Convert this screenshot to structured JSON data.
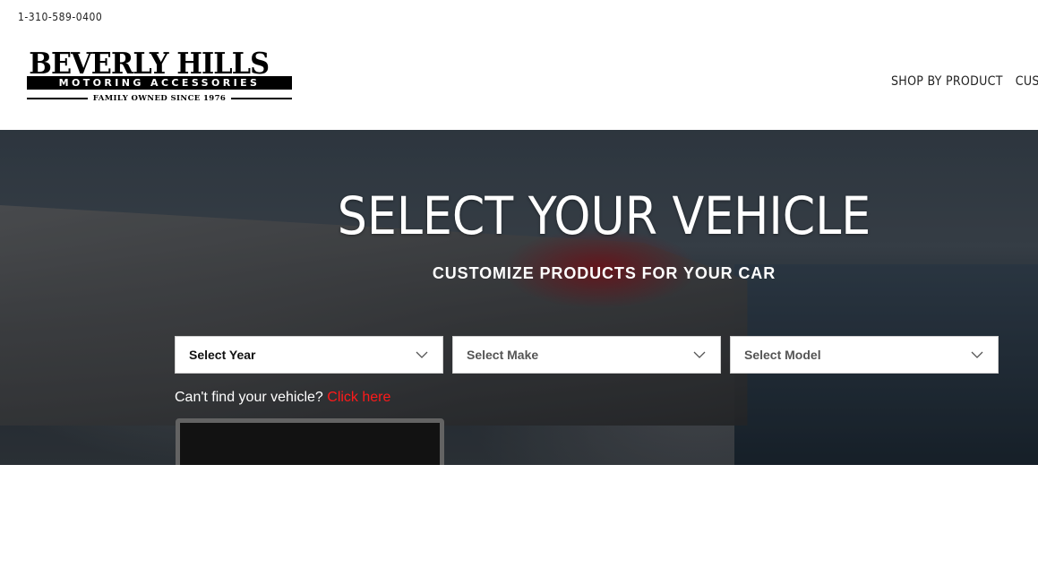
{
  "topbar": {
    "phone": "1-310-589-0400"
  },
  "logo": {
    "line1": "BEVERLY HILLS",
    "line2": "MOTORING ACCESSORIES",
    "tagline": "FAMILY OWNED SINCE 1976"
  },
  "nav": {
    "items": [
      {
        "label": "SHOP BY PRODUCT"
      },
      {
        "label": "CUSTO"
      }
    ]
  },
  "hero": {
    "title": "SELECT YOUR VEHICLE",
    "subtitle": "CUSTOMIZE PRODUCTS FOR YOUR CAR",
    "selects": [
      {
        "placeholder": "Select Year",
        "icon": "chevron-down-icon"
      },
      {
        "placeholder": "Select Make",
        "icon": "chevron-down-icon"
      },
      {
        "placeholder": "Select Model",
        "icon": "chevron-down-icon"
      }
    ],
    "cant_find_text": "Can't find your vehicle?",
    "click_here": "Click here",
    "accent_color": "#ff1a1a"
  }
}
